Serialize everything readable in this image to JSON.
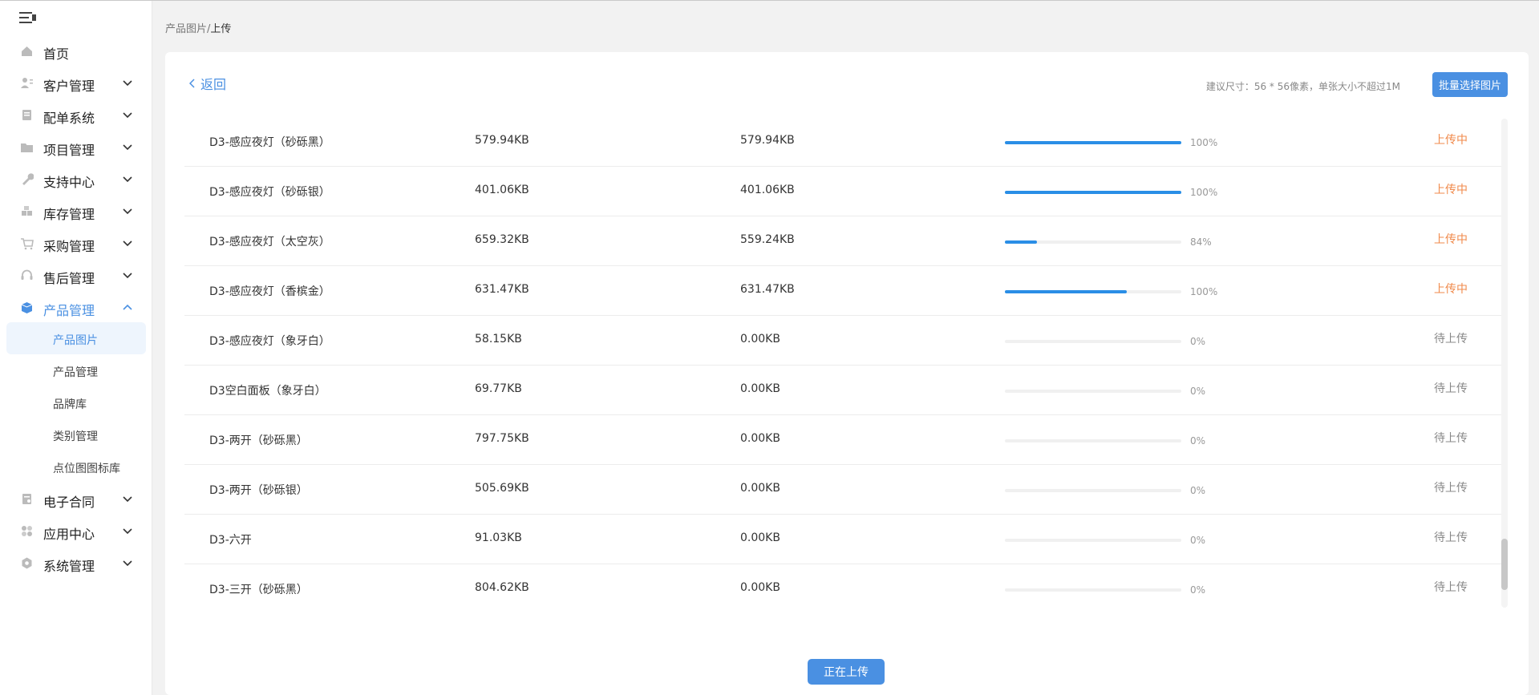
{
  "sidebar": {
    "items": [
      {
        "label": "首页",
        "icon": "home-icon",
        "has_chevron": false
      },
      {
        "label": "客户管理",
        "icon": "customer-icon",
        "has_chevron": true
      },
      {
        "label": "配单系统",
        "icon": "order-icon",
        "has_chevron": true
      },
      {
        "label": "项目管理",
        "icon": "folder-icon",
        "has_chevron": true
      },
      {
        "label": "支持中心",
        "icon": "wrench-icon",
        "has_chevron": true
      },
      {
        "label": "库存管理",
        "icon": "inventory-icon",
        "has_chevron": true
      },
      {
        "label": "采购管理",
        "icon": "cart-icon",
        "has_chevron": true
      },
      {
        "label": "售后管理",
        "icon": "headset-icon",
        "has_chevron": true
      },
      {
        "label": "产品管理",
        "icon": "box-icon",
        "has_chevron": true,
        "expanded": true
      },
      {
        "label": "电子合同",
        "icon": "contract-icon",
        "has_chevron": true
      },
      {
        "label": "应用中心",
        "icon": "apps-icon",
        "has_chevron": true
      },
      {
        "label": "系统管理",
        "icon": "settings-icon",
        "has_chevron": true
      }
    ],
    "sub_items": [
      {
        "label": "产品图片",
        "selected": true
      },
      {
        "label": "产品管理",
        "selected": false
      },
      {
        "label": "品牌库",
        "selected": false
      },
      {
        "label": "类别管理",
        "selected": false
      },
      {
        "label": "点位图图标库",
        "selected": false
      }
    ]
  },
  "breadcrumb": {
    "parent": "产品图片",
    "separator": "/",
    "current": "上传"
  },
  "header": {
    "back_label": "返回",
    "hint": "建议尺寸：56 * 56像素，单张大小不超过1M",
    "batch_button": "批量选择图片"
  },
  "files": [
    {
      "name": "D3-感应夜灯（砂砾黑）",
      "size": "579.94KB",
      "uploaded": "579.94KB",
      "progress": 100,
      "progress_label": "100%",
      "status": "上传中",
      "status_type": "uploading"
    },
    {
      "name": "D3-感应夜灯（砂砾银）",
      "size": "401.06KB",
      "uploaded": "401.06KB",
      "progress": 100,
      "progress_label": "100%",
      "status": "上传中",
      "status_type": "uploading"
    },
    {
      "name": "D3-感应夜灯（太空灰）",
      "size": "659.32KB",
      "uploaded": "559.24KB",
      "progress": 18,
      "progress_label": "84%",
      "status": "上传中",
      "status_type": "uploading"
    },
    {
      "name": "D3-感应夜灯（香槟金）",
      "size": "631.47KB",
      "uploaded": "631.47KB",
      "progress": 69,
      "progress_label": "100%",
      "status": "上传中",
      "status_type": "uploading"
    },
    {
      "name": "D3-感应夜灯（象牙白）",
      "size": "58.15KB",
      "uploaded": "0.00KB",
      "progress": 0,
      "progress_label": "0%",
      "status": "待上传",
      "status_type": "waiting"
    },
    {
      "name": "D3空白面板（象牙白）",
      "size": "69.77KB",
      "uploaded": "0.00KB",
      "progress": 0,
      "progress_label": "0%",
      "status": "待上传",
      "status_type": "waiting"
    },
    {
      "name": "D3-两开（砂砾黑）",
      "size": "797.75KB",
      "uploaded": "0.00KB",
      "progress": 0,
      "progress_label": "0%",
      "status": "待上传",
      "status_type": "waiting"
    },
    {
      "name": "D3-两开（砂砾银）",
      "size": "505.69KB",
      "uploaded": "0.00KB",
      "progress": 0,
      "progress_label": "0%",
      "status": "待上传",
      "status_type": "waiting"
    },
    {
      "name": "D3-六开",
      "size": "91.03KB",
      "uploaded": "0.00KB",
      "progress": 0,
      "progress_label": "0%",
      "status": "待上传",
      "status_type": "waiting"
    },
    {
      "name": "D3-三开（砂砾黑）",
      "size": "804.62KB",
      "uploaded": "0.00KB",
      "progress": 0,
      "progress_label": "0%",
      "status": "待上传",
      "status_type": "waiting"
    }
  ],
  "footer": {
    "upload_button": "正在上传"
  },
  "colors": {
    "accent": "#4a90e2",
    "progress": "#2a8ee6",
    "uploading": "#f08a4b",
    "waiting": "#888888"
  }
}
